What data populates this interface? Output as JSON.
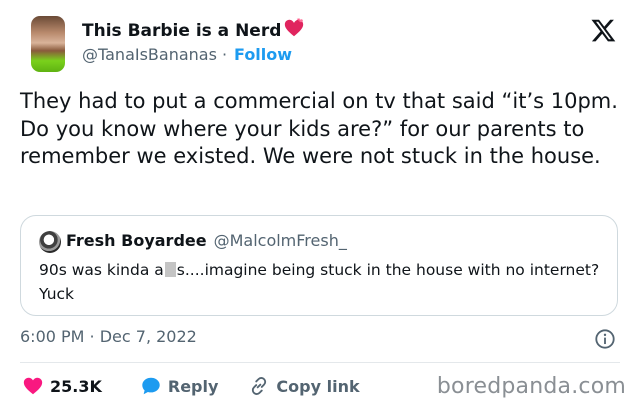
{
  "author": {
    "display_name": "This Barbie is a Nerd",
    "handle": "@TanaIsBananas",
    "separator": "·",
    "follow_label": "Follow"
  },
  "tweet": {
    "text": "They had to put a commercial on tv that said “it’s 10pm. Do you know where your kids are?” for our parents to remember we existed. We were not stuck in the house."
  },
  "quoted": {
    "display_name": "Fresh Boyardee",
    "handle": "@MalcolmFresh_",
    "text_before": "90s was kinda a",
    "text_after": "s....imagine being stuck in the house with no internet? Yuck"
  },
  "meta": {
    "timestamp": "6:00 PM · Dec 7, 2022"
  },
  "actions": {
    "likes": "25.3K",
    "reply_label": "Reply",
    "copy_link_label": "Copy link"
  },
  "watermark": "boredpanda.com",
  "colors": {
    "accent": "#1d9bf0",
    "like": "#f91880",
    "muted": "#536471",
    "text": "#0f1419"
  },
  "icons": [
    "heart-emoji-icon",
    "x-logo-icon",
    "info-icon",
    "like-heart-icon",
    "reply-bubble-icon",
    "link-icon"
  ]
}
